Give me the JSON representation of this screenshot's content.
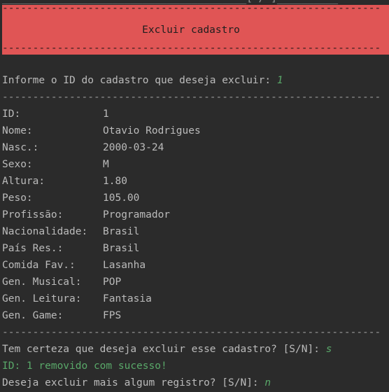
{
  "top_clipped_text": "________________________________________[ / ]__________",
  "banner": {
    "dashes": "--------------------------------------------------------------",
    "title": "Excluir cadastro"
  },
  "prompt_id": {
    "question": "Informe o ID do cadastro que deseja excluir: ",
    "answer": "1"
  },
  "separator": "--------------------------------------------------------------",
  "record": [
    {
      "key": "ID:",
      "value": "1"
    },
    {
      "key": "Nome:",
      "value": "Otavio Rodrigues"
    },
    {
      "key": "Nasc.:",
      "value": "2000-03-24"
    },
    {
      "key": "Sexo:",
      "value": "M"
    },
    {
      "key": "Altura:",
      "value": "1.80"
    },
    {
      "key": "Peso:",
      "value": "105.00"
    },
    {
      "key": "Profissão:",
      "value": "Programador"
    },
    {
      "key": "Nacionalidade:",
      "value": "Brasil"
    },
    {
      "key": "País Res.:",
      "value": "Brasil"
    },
    {
      "key": "Comida Fav.:",
      "value": "Lasanha"
    },
    {
      "key": "Gen. Musical:",
      "value": "POP"
    },
    {
      "key": "Gen. Leitura:",
      "value": "Fantasia"
    },
    {
      "key": "Gen. Game:",
      "value": "FPS"
    }
  ],
  "confirm": {
    "question": "Tem certeza que deseja excluir esse cadastro? [S/N]: ",
    "answer": "s"
  },
  "result_message": "ID: 1 removido com sucesso!",
  "again": {
    "question": "Deseja excluir mais algum registro? [S/N]: ",
    "answer": "n"
  },
  "colors": {
    "background": "#2b2b2b",
    "text": "#bbbbbb",
    "banner": "#e05555",
    "input_green": "#59a869"
  }
}
